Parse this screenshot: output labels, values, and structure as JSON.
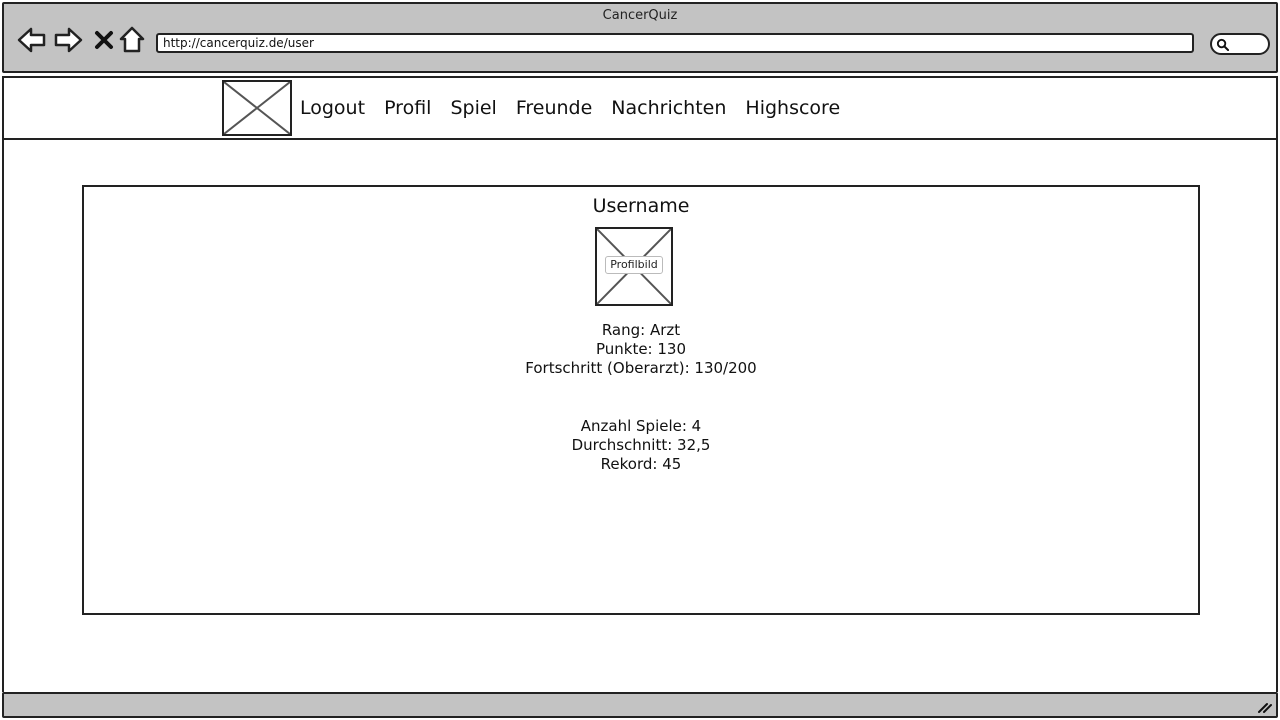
{
  "window": {
    "title": "CancerQuiz"
  },
  "browser": {
    "url": "http://cancerquiz.de/user",
    "icons": [
      "back-arrow-icon",
      "forward-arrow-icon",
      "close-x-icon",
      "home-icon",
      "search-icon"
    ]
  },
  "nav": {
    "items": [
      {
        "label": "Logout"
      },
      {
        "label": "Profil"
      },
      {
        "label": "Spiel"
      },
      {
        "label": "Freunde"
      },
      {
        "label": "Nachrichten"
      },
      {
        "label": "Highscore"
      }
    ]
  },
  "profile": {
    "username": "Username",
    "avatar_label": "Profilbild",
    "stats_primary": [
      "Rang: Arzt",
      "Punkte: 130",
      "Fortschritt (Oberarzt): 130/200"
    ],
    "stats_secondary": [
      "Anzahl Spiele: 4",
      "Durchschnitt: 32,5",
      "Rekord: 45"
    ]
  }
}
